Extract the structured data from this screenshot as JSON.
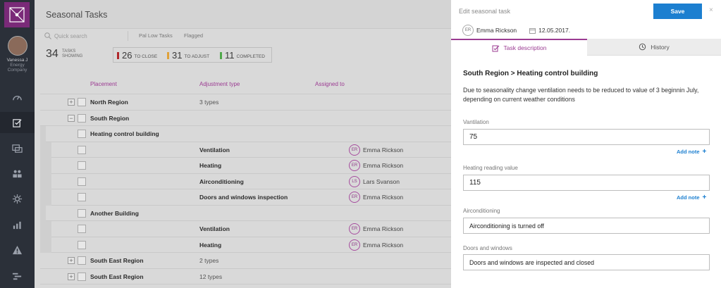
{
  "nav": {
    "user_name": "Vanessa J",
    "company": "Energy Company"
  },
  "main": {
    "title": "Seasonal Tasks",
    "search_placeholder": "Quick search",
    "filters": [
      "Pal Low Tasks",
      "Flagged"
    ],
    "summary": {
      "count": "34",
      "count_label_1": "TASKS",
      "count_label_2": "SHOWING",
      "stats": [
        {
          "num": "26",
          "label": "TO CLOSE",
          "color": "#b0282b"
        },
        {
          "num": "31",
          "label": "TO ADJUST",
          "color": "#e0a23a"
        },
        {
          "num": "11",
          "label": "COMPLETED",
          "color": "#4fa84a"
        }
      ]
    },
    "columns": [
      "Placement",
      "Adjustment type",
      "Assigned to"
    ],
    "rows": [
      {
        "name": "North Region",
        "adj": "3 types"
      },
      {
        "name": "South Region"
      },
      {
        "name": "Heating control building"
      },
      {
        "adj": "Ventilation",
        "initials": "ER",
        "who": "Emma Rickson"
      },
      {
        "adj": "Heating",
        "initials": "ER",
        "who": "Emma Rickson"
      },
      {
        "adj": "Airconditioning",
        "initials": "LS",
        "who": "Lars Svanson"
      },
      {
        "adj": "Doors and windows inspection",
        "initials": "ER",
        "who": "Emma Rickson"
      },
      {
        "name": "Another Building"
      },
      {
        "adj": "Ventilation",
        "initials": "ER",
        "who": "Emma Rickson"
      },
      {
        "adj": "Heating",
        "initials": "ER",
        "who": "Emma Rickson"
      },
      {
        "name": "South East Region",
        "adj": "2 types"
      },
      {
        "name": "South East Region",
        "adj": "12 types"
      }
    ]
  },
  "panel": {
    "title": "Edit seasonal task",
    "save_label": "Save",
    "close": "×",
    "assignee_initials": "ER",
    "assignee": "Emma Rickson",
    "date": "12.05.2017.",
    "tab_description": "Task description",
    "tab_history": "History",
    "section_title": "South Region > Heating control building",
    "description": "Due to seasonality change ventilation needs to be reduced to value of 3 beginnin July, depending on current weather conditions",
    "fields": [
      {
        "label": "Vantilation",
        "value": "75"
      },
      {
        "label": "Heating reading value",
        "value": "115"
      },
      {
        "label": "Airconditioning",
        "value": "Airconditioning is turned off"
      },
      {
        "label": "Doors and windows",
        "value": "Doors and windows are inspected and closed"
      }
    ],
    "add_note": "Add note",
    "plus": "+"
  },
  "colors": {
    "accent": "#9b3b92",
    "save": "#1c7fd0",
    "nav": "#2b3039"
  }
}
